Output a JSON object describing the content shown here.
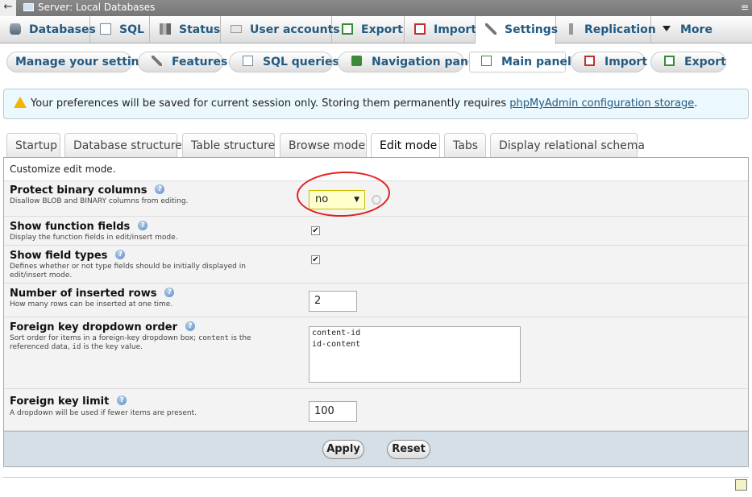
{
  "titlebar": {
    "server_label": "Server: Local Databases",
    "back_glyph": "←",
    "collapse_glyph": "≡"
  },
  "topmenu": [
    {
      "label": "Databases",
      "icon": "database-icon"
    },
    {
      "label": "SQL",
      "icon": "sql-icon"
    },
    {
      "label": "Status",
      "icon": "status-icon"
    },
    {
      "label": "User accounts",
      "icon": "users-icon"
    },
    {
      "label": "Export",
      "icon": "export-icon"
    },
    {
      "label": "Import",
      "icon": "import-icon"
    },
    {
      "label": "Settings",
      "icon": "wrench-icon"
    },
    {
      "label": "Replication",
      "icon": "replication-icon"
    },
    {
      "label": "More",
      "icon": "chevron-down-icon"
    }
  ],
  "subtabs": [
    {
      "label": "Manage your settings"
    },
    {
      "label": "Features"
    },
    {
      "label": "SQL queries"
    },
    {
      "label": "Navigation panel"
    },
    {
      "label": "Main panel"
    },
    {
      "label": "Import"
    },
    {
      "label": "Export"
    }
  ],
  "notice": {
    "text": "Your preferences will be saved for current session only. Storing them permanently requires ",
    "link": "phpMyAdmin configuration storage",
    "suffix": "."
  },
  "formtabs": [
    {
      "label": "Startup"
    },
    {
      "label": "Database structure"
    },
    {
      "label": "Table structure"
    },
    {
      "label": "Browse mode"
    },
    {
      "label": "Edit mode"
    },
    {
      "label": "Tabs"
    },
    {
      "label": "Display relational schema"
    }
  ],
  "form": {
    "intro": "Customize edit mode.",
    "protect_binary": {
      "title": "Protect binary columns",
      "desc": "Disallow BLOB and BINARY columns from editing.",
      "value": "no"
    },
    "function_fields": {
      "title": "Show function fields",
      "desc": "Display the function fields in edit/insert mode.",
      "checked": true,
      "mark": "✔"
    },
    "field_types": {
      "title": "Show field types",
      "desc": "Defines whether or not type fields should be initially displayed in edit/insert mode.",
      "checked": true,
      "mark": "✔"
    },
    "inserted_rows": {
      "title": "Number of inserted rows",
      "desc": "How many rows can be inserted at one time.",
      "value": "2"
    },
    "fk_order": {
      "title": "Foreign key dropdown order",
      "desc_a": "Sort order for items in a foreign-key dropdown box; ",
      "desc_code1": "content",
      "desc_b": " is the referenced data, ",
      "desc_code2": "id",
      "desc_c": " is the key value.",
      "value": "content-id\nid-content"
    },
    "fk_limit": {
      "title": "Foreign key limit",
      "desc": "A dropdown will be used if fewer items are present.",
      "value": "100"
    }
  },
  "buttons": {
    "apply": "Apply",
    "reset": "Reset"
  },
  "colors": {
    "accent": "#235a81",
    "annotation": "#e02020",
    "footer": "#d5dfe8"
  }
}
